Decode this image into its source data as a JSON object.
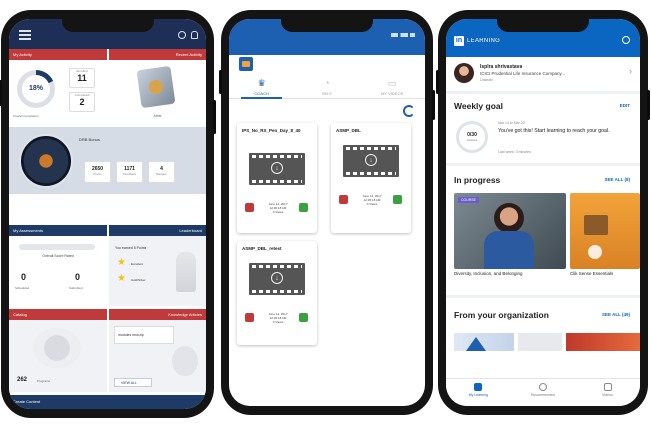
{
  "phone1": {
    "my_activity": "My Activity",
    "recent_activity": "Recent Activity",
    "completion_percent": "18%",
    "completion_caption": "Overall Completion",
    "stat_a_value": "11",
    "stat_a_label": "Enrolled",
    "stat_b_value": "2",
    "stat_b_label": "Completed",
    "recent_item": "Artist",
    "points_title": "DRB Bonus",
    "points": [
      {
        "value": "2650",
        "label": "Points"
      },
      {
        "value": "1171",
        "label": "Feedback"
      },
      {
        "value": "4",
        "label": "Badges"
      }
    ],
    "my_assessments": "My Assessments",
    "leaderboard": "Leaderboard",
    "overall_score_label": "Overall Score Rated",
    "scheduled": {
      "value": "0",
      "label": "Scheduled"
    },
    "submitted": {
      "value": "0",
      "label": "Submitted"
    },
    "leader_text": "You earned 5 Points",
    "leader_rows": [
      "Excellent",
      "Gold/Silver"
    ],
    "catalog": "Catalog",
    "knowledge": "Knowledge Articles",
    "catalog_count": "262",
    "catalog_count_label": "Programs",
    "knowledge_item": "modules new.zip",
    "view_all": "VIEW ALL",
    "bottom_bar": "Create Content"
  },
  "phone2": {
    "tabs": [
      {
        "label": "COACH",
        "icon": "crown-icon"
      },
      {
        "label": "SELF",
        "icon": "user-icon"
      },
      {
        "label": "MY VIDEOS",
        "icon": "video-icon"
      }
    ],
    "cards": [
      {
        "title": "IPS_No_RX_Pen_Day_8_40",
        "date_line1": "June 14, 2017",
        "date_line2": "12:36:18 AM",
        "date_line3": "0 Views"
      },
      {
        "title": "ASMP_DBL",
        "date_line1": "June 14, 2017",
        "date_line2": "12:36:18 AM",
        "date_line3": "0 Views"
      },
      {
        "title": "ASMP_DBL_retest",
        "date_line1": "June 14, 2017",
        "date_line2": "12:36:18 AM",
        "date_line3": "0 Views"
      }
    ]
  },
  "phone3": {
    "brand": "LEARNING",
    "user_name": "Isplra shrivastava",
    "user_company": "ICICI Prudential Life Insurance Company...",
    "user_link": "Linkedin",
    "weekly_goal": "Weekly goal",
    "edit": "EDIT",
    "goal_value": "0/30",
    "goal_unit": "minutes",
    "goal_date": "Mar 14 to Mar 20",
    "goal_message": "You've got this! Start learning to reach your goal.",
    "goal_sub": "Last week: 0 minutes",
    "in_progress": "In progress",
    "see_all_in_progress": "SEE ALL (8)",
    "course1": "Diversity, Inclusion, and Belonging",
    "course1_tag": "COURSE",
    "course2": "Clik Sense Essentials",
    "from_org": "From your organization",
    "see_all_org": "SEE ALL (49)",
    "nav": [
      {
        "label": "My Learning"
      },
      {
        "label": "Recommended"
      },
      {
        "label": "Videos"
      }
    ]
  }
}
